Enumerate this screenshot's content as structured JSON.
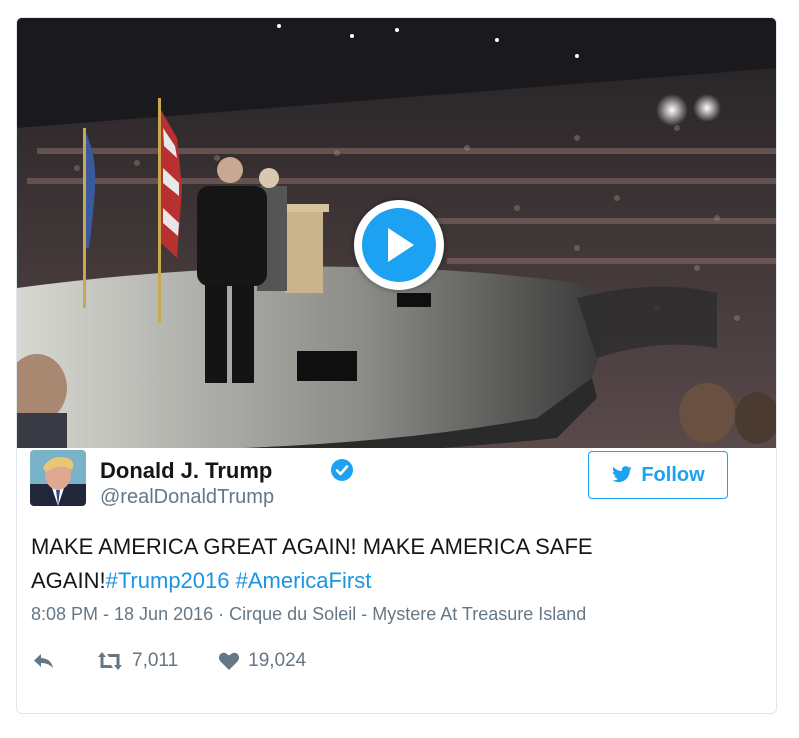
{
  "tweet": {
    "author_name": "Donald J. Trump",
    "author_handle": "@realDonaldTrump",
    "text_plain": "MAKE AMERICA GREAT AGAIN! MAKE AMERICA SAFE AGAIN!",
    "hashtags": [
      "#Trump2016",
      "#AmericaFirst"
    ],
    "time": "8:08 PM - 18 Jun 2016",
    "separator": " · ",
    "location": "Cirque du Soleil - Mystere At Treasure Island",
    "retweets": "7,011",
    "likes": "19,024"
  },
  "follow_button": {
    "label": "Follow",
    "icon": "twitter-bird-icon"
  },
  "media": {
    "type": "video",
    "icon": "play-icon"
  },
  "colors": {
    "accent": "#1da1f2",
    "link": "#1b95e0",
    "muted": "#657786",
    "text": "#14171a",
    "border": "#e1e8ed"
  },
  "icons": [
    "verified-badge-icon",
    "reply-icon",
    "retweet-icon",
    "heart-icon"
  ]
}
